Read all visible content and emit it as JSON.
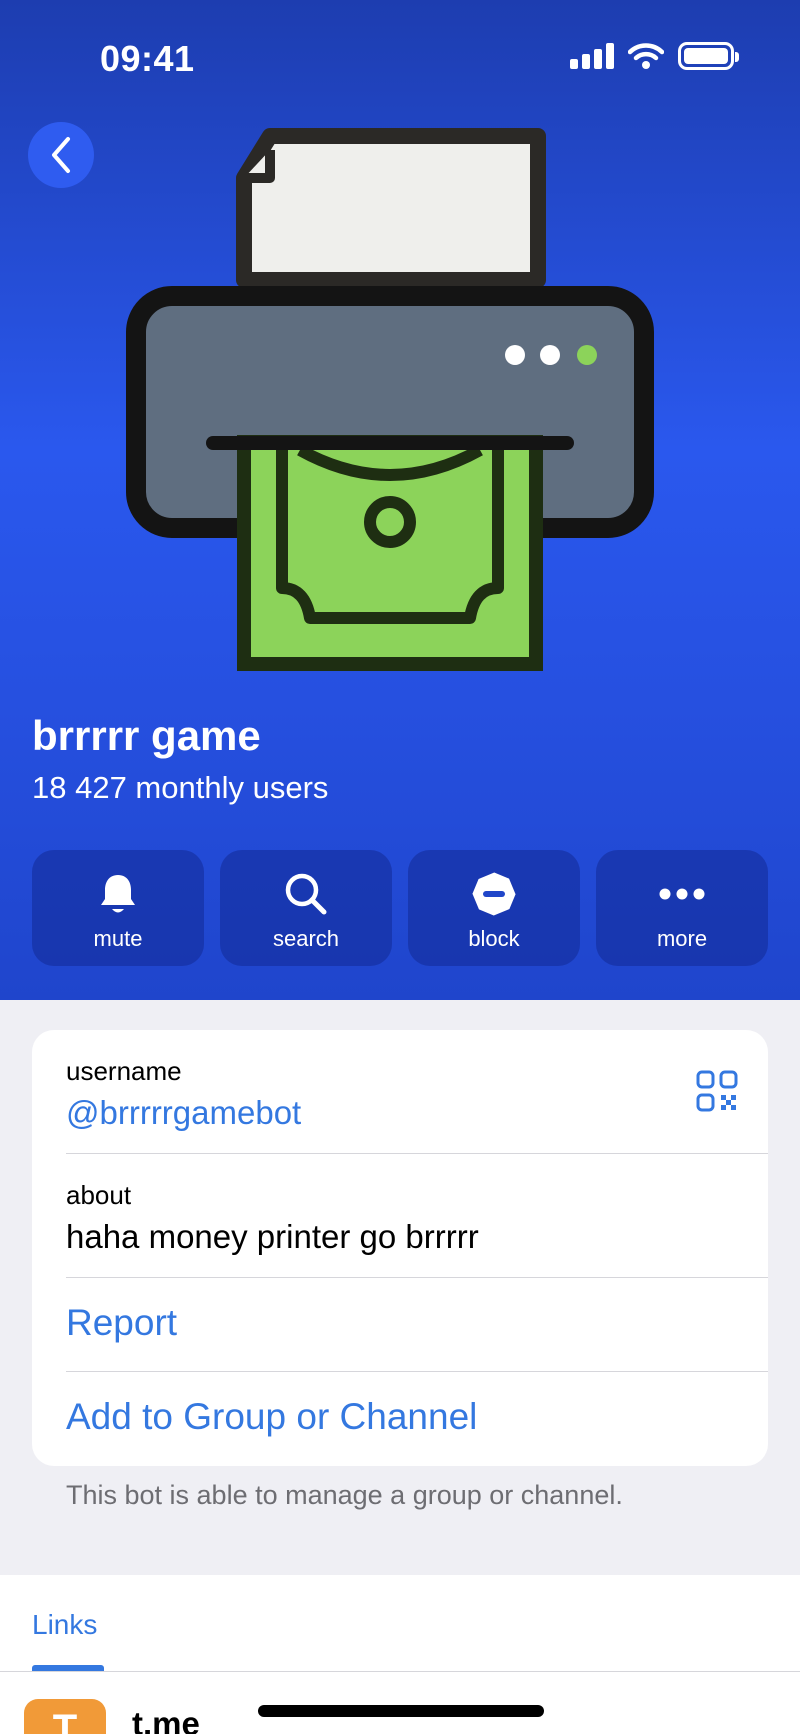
{
  "status_bar": {
    "time": "09:41"
  },
  "header": {
    "bot_name": "brrrrr game",
    "subtitle": "18 427 monthly users",
    "actions": [
      {
        "label": "mute",
        "icon": "bell-icon"
      },
      {
        "label": "search",
        "icon": "search-icon"
      },
      {
        "label": "block",
        "icon": "block-icon"
      },
      {
        "label": "more",
        "icon": "ellipsis-icon"
      }
    ]
  },
  "info": {
    "username_label": "username",
    "username_value": "@brrrrrgamebot",
    "about_label": "about",
    "about_value": "haha money printer go brrrrr",
    "report_label": "Report",
    "add_label": "Add to Group or Channel",
    "note": "This bot is able to manage a group or channel."
  },
  "links": {
    "title": "Links",
    "first_link_icon_letter": "T",
    "first_link_text": "t.me"
  },
  "colors": {
    "header_blue": "#2a58ee",
    "link_blue": "#3478e0",
    "money_green": "#8cd35a",
    "printer_gray": "#5f6e80",
    "link_icon_orange": "#f19a38"
  }
}
